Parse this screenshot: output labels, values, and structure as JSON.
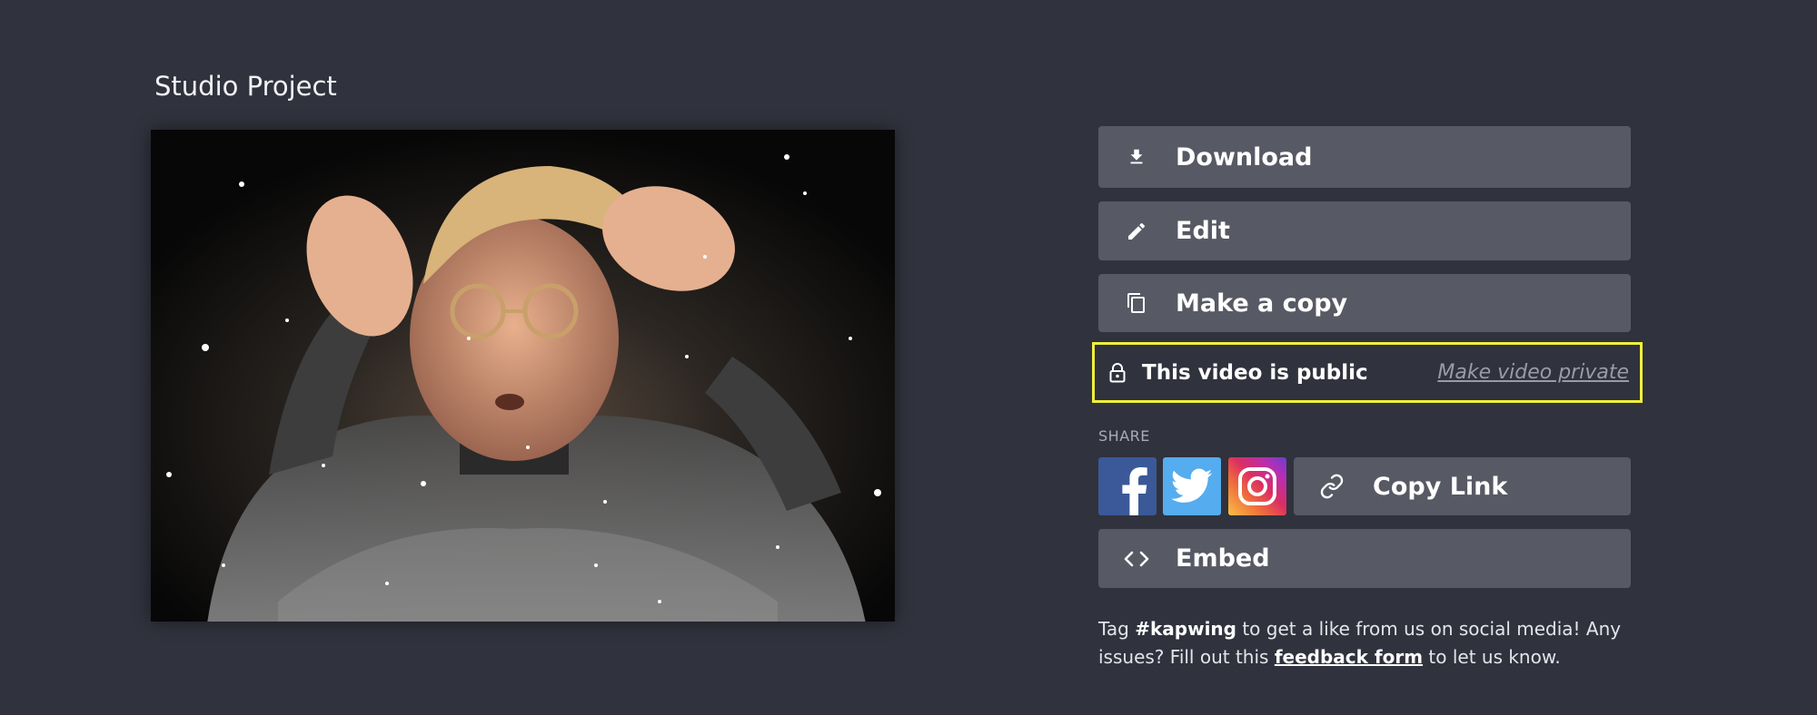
{
  "project": {
    "title": "Studio Project"
  },
  "actions": {
    "download": "Download",
    "edit": "Edit",
    "copy": "Make a copy",
    "embed": "Embed"
  },
  "privacy": {
    "status": "This video is public",
    "toggle": "Make video private",
    "highlight_color": "#eef03a"
  },
  "share": {
    "label": "SHARE",
    "networks": [
      "facebook",
      "twitter",
      "instagram"
    ],
    "copy_link": "Copy Link"
  },
  "footer": {
    "tag_prefix": "Tag ",
    "hashtag": "#kapwing",
    "tag_suffix": " to get a like from us on social media! Any issues? Fill out this ",
    "form_link": "feedback form",
    "closing": " to let us know."
  },
  "icons": {
    "download": "download-icon",
    "edit": "pencil-icon",
    "copy": "copy-icon",
    "lock": "lock-icon",
    "link": "link-icon",
    "embed": "code-icon"
  },
  "colors": {
    "background": "#30323d",
    "button": "#575964",
    "facebook": "#3b5998",
    "twitter": "#55acee"
  }
}
